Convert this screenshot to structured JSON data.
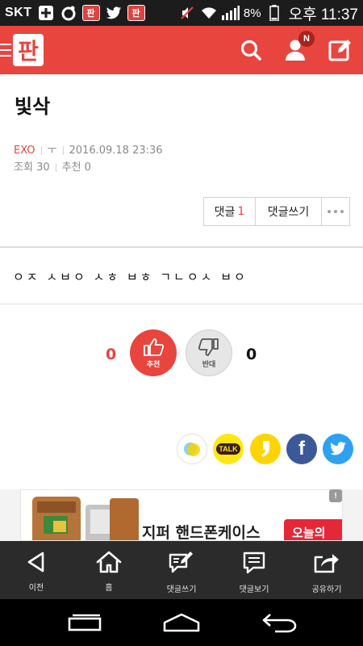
{
  "status_bar": {
    "carrier": "SKT",
    "battery": "8%",
    "time": "오후 11:37",
    "app_badge_label": "판"
  },
  "header": {
    "logo_text": "판",
    "notification_badge": "N"
  },
  "post": {
    "title": "빛삭",
    "author": "EXO",
    "author_extra": "ㅜ",
    "datetime": "2016.09.18 23:36",
    "views_label": "조회",
    "views": "30",
    "recommends_label": "추천",
    "recommends": "0",
    "body": "ㅇㅈ ㅅㅂㅇ ㅅㅎ ㅂㅎ ㄱㄴㅇㅅ ㅂㅇ"
  },
  "actions": {
    "comments_label": "댓글",
    "comments_count": "1",
    "write_comment_label": "댓글쓰기"
  },
  "vote": {
    "up_count": "0",
    "up_label": "추천",
    "down_label": "반대",
    "down_count": "0"
  },
  "share": {
    "items": [
      "kakaostory-icon",
      "kakaotalk-icon",
      "story-icon",
      "facebook-icon",
      "twitter-icon"
    ],
    "talk_label": "TALK",
    "facebook_letter": "f"
  },
  "ad": {
    "text": "지퍼 핸드폰케이스",
    "cta": "오늘의",
    "info": "!"
  },
  "toolbar": {
    "items": [
      {
        "label": "이전",
        "icon": "back-icon"
      },
      {
        "label": "홈",
        "icon": "home-icon"
      },
      {
        "label": "댓글쓰기",
        "icon": "write-comment-icon"
      },
      {
        "label": "댓글보기",
        "icon": "view-comments-icon"
      },
      {
        "label": "공유하기",
        "icon": "share-icon"
      }
    ]
  },
  "colors": {
    "brand": "#e8453e",
    "toolbar": "#2b2b2b",
    "status_bar": "#1c1c1c"
  }
}
